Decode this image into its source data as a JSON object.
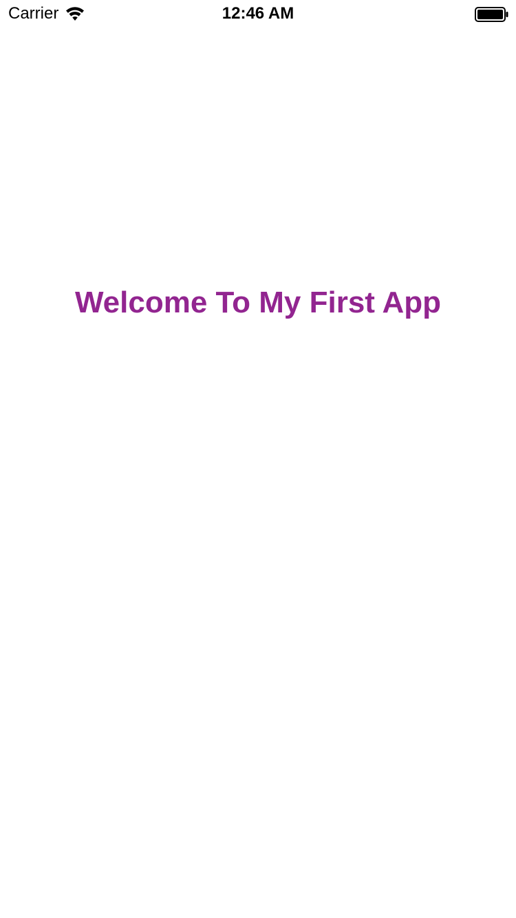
{
  "status_bar": {
    "carrier": "Carrier",
    "time": "12:46 AM",
    "wifi_icon": "wifi-icon",
    "battery_icon": "battery-full-icon"
  },
  "main": {
    "title": "Welcome To My First App"
  },
  "colors": {
    "title": "#922590",
    "background": "#ffffff",
    "status_text": "#000000"
  }
}
